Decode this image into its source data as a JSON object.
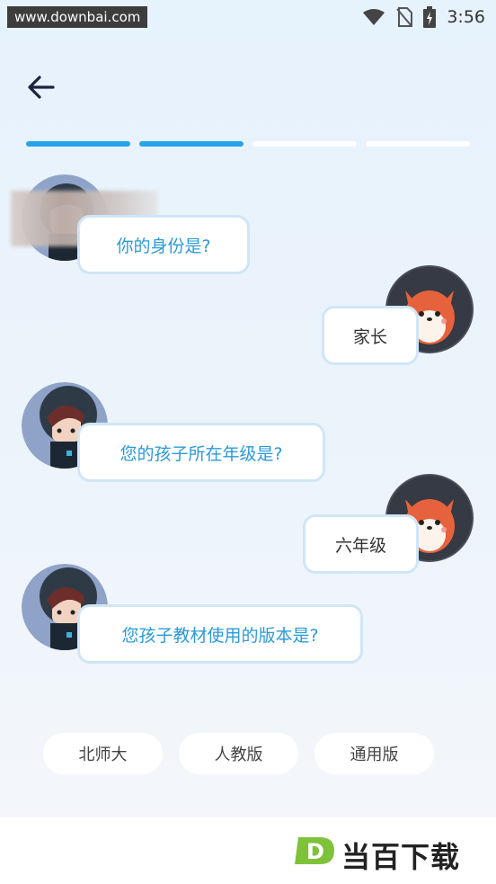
{
  "status_bar": {
    "watermark": "www.downbai.com",
    "time": "3:56"
  },
  "progress": {
    "total_steps": 4,
    "completed_steps": 2
  },
  "chat": [
    {
      "role": "bot",
      "text": "你的身份是?"
    },
    {
      "role": "user",
      "text": "家长"
    },
    {
      "role": "bot",
      "text": "您的孩子所在年级是?"
    },
    {
      "role": "user",
      "text": "六年级"
    },
    {
      "role": "bot",
      "text": "您孩子教材使用的版本是?"
    }
  ],
  "options": [
    "北师大",
    "人教版",
    "通用版"
  ],
  "footer": {
    "logo_letter": "D",
    "brand": "当百下载"
  },
  "colors": {
    "accent": "#27a3ea",
    "question_text": "#2b9ad8",
    "bubble_border": "#cfe6f7"
  },
  "icons": [
    "back-arrow-icon",
    "wifi-icon",
    "no-sim-icon",
    "battery-charging-icon"
  ]
}
